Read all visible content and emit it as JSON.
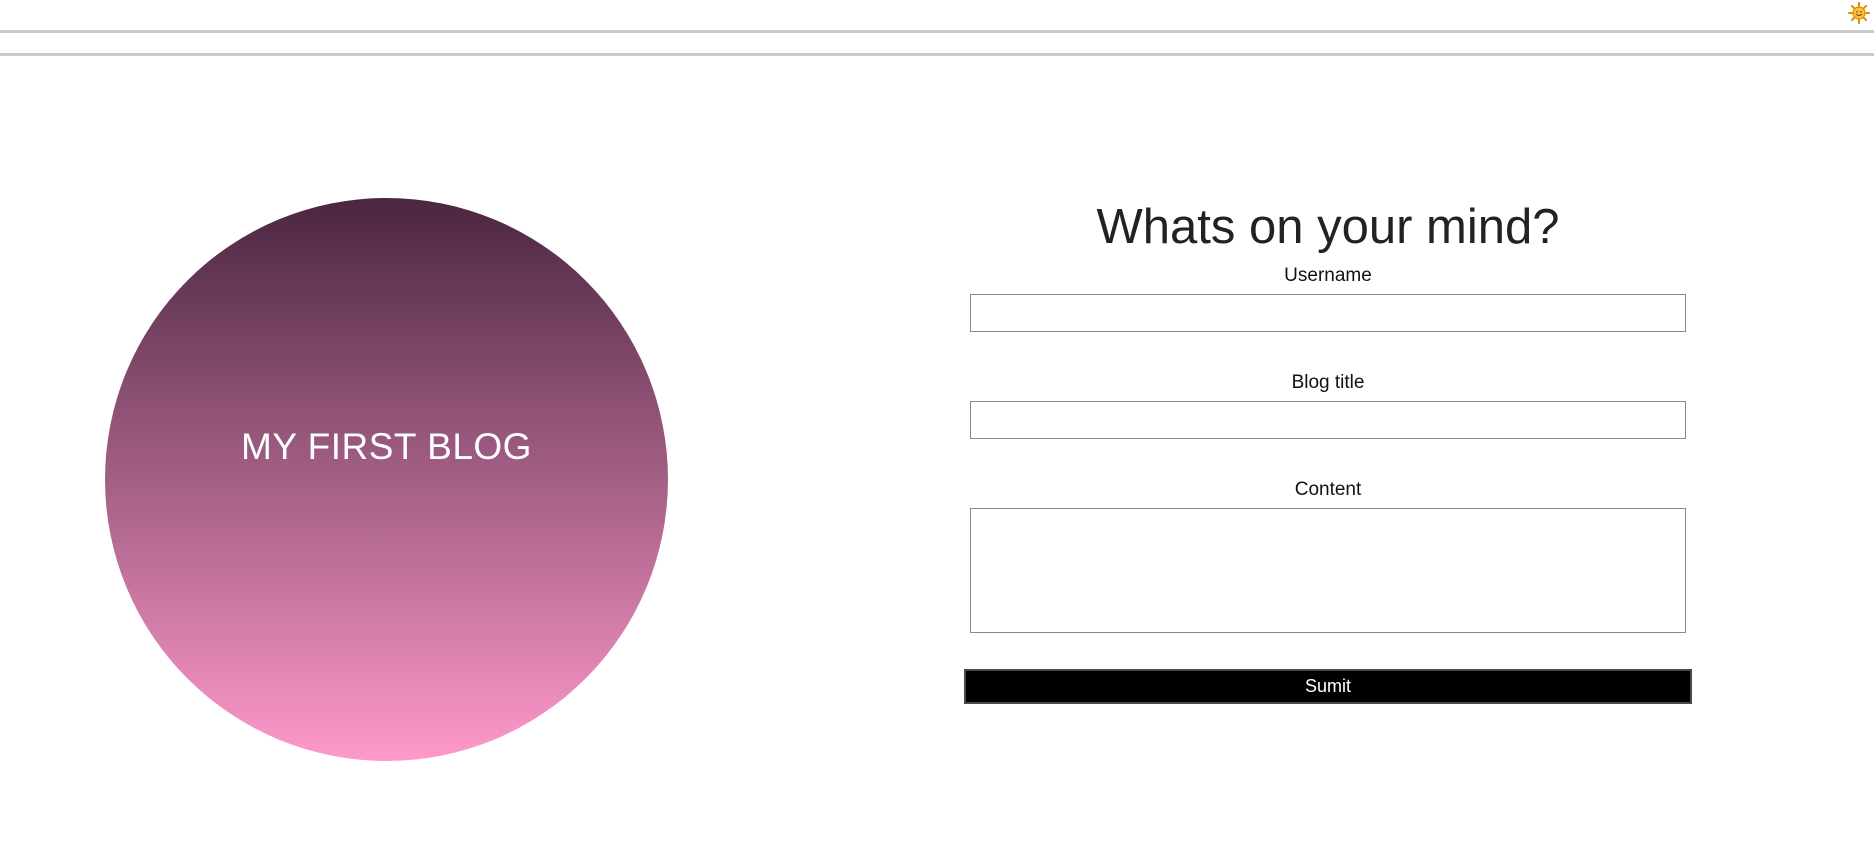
{
  "header": {
    "theme_icon": "sun-icon"
  },
  "hero": {
    "title": "MY FIRST BLOG",
    "gradient_top": "#4a2640",
    "gradient_bottom": "#ff99cc"
  },
  "form": {
    "heading": "Whats on your mind?",
    "username_label": "Username",
    "username_value": "",
    "blog_title_label": "Blog title",
    "blog_title_value": "",
    "content_label": "Content",
    "content_value": "",
    "submit_label": "Sumit"
  }
}
